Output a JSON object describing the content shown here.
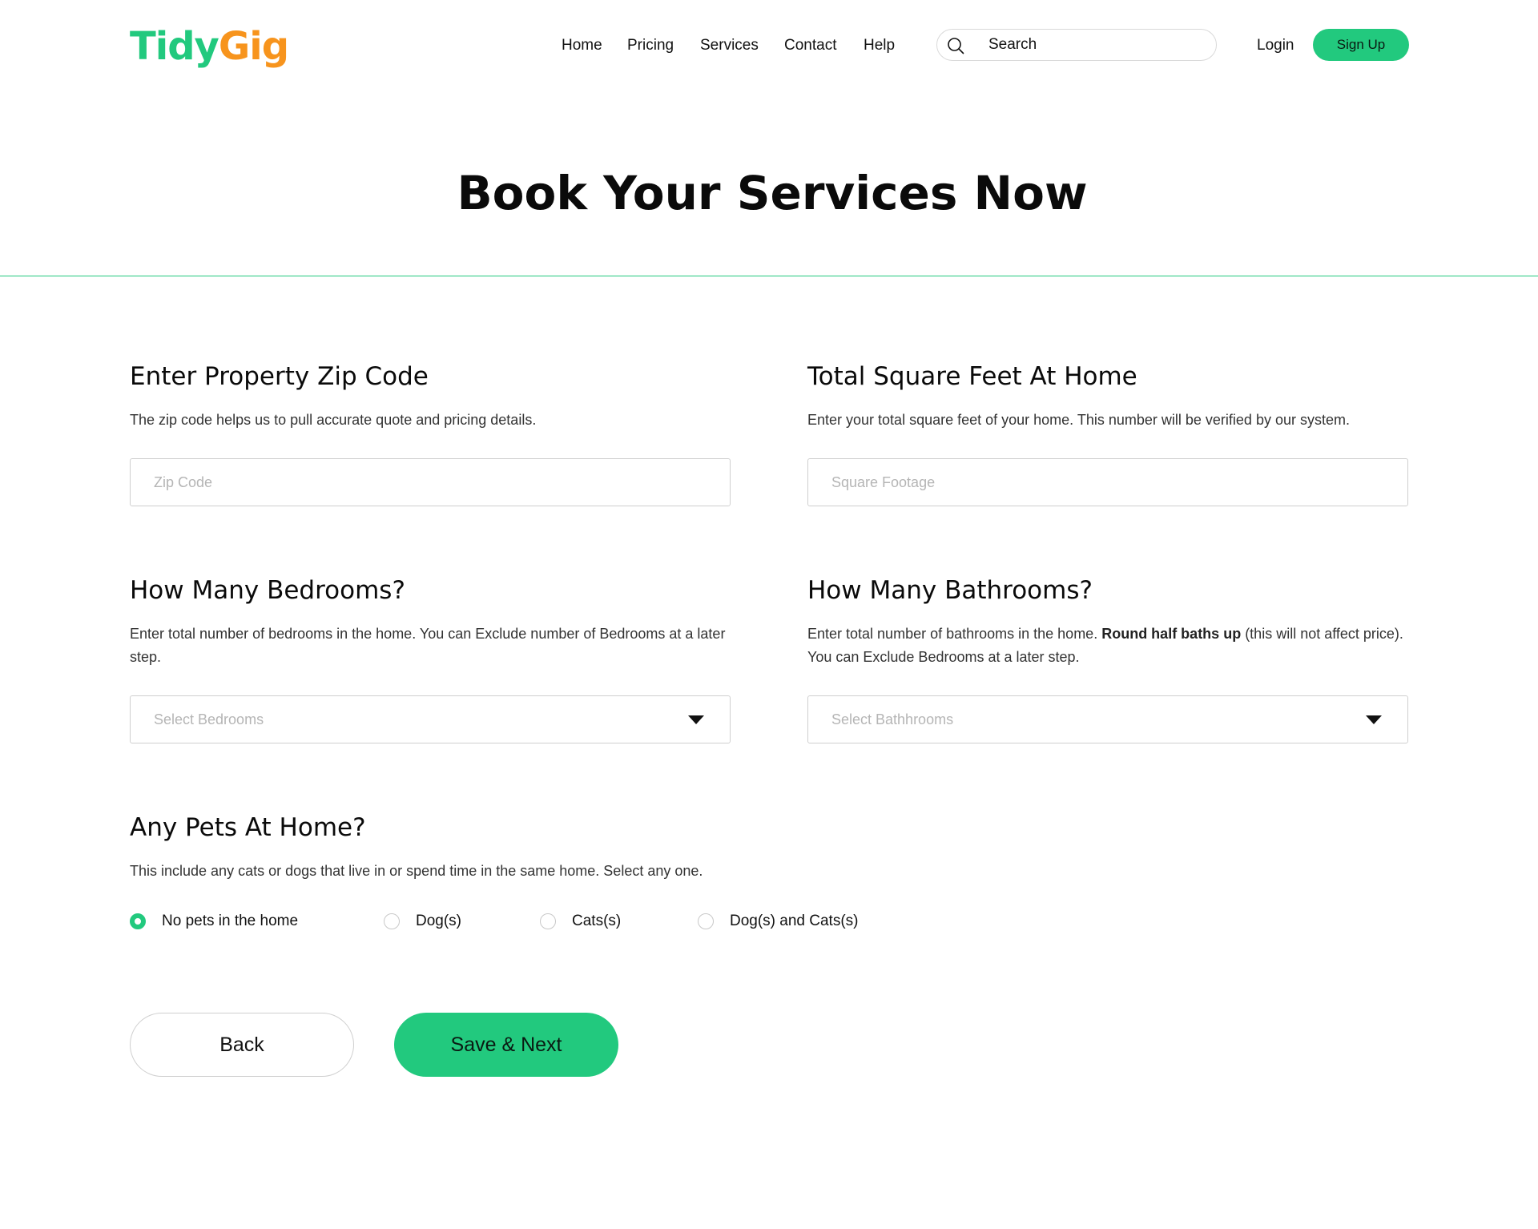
{
  "brand": {
    "part1": "Tidy",
    "part2": "Gig"
  },
  "nav": {
    "items": [
      "Home",
      "Pricing",
      "Services",
      "Contact",
      "Help"
    ],
    "search_placeholder": "Search",
    "login": "Login",
    "signup": "Sign Up"
  },
  "page": {
    "title": "Book Your Services Now"
  },
  "form": {
    "zip": {
      "title": "Enter Property Zip Code",
      "description": "The zip code helps us to pull accurate quote and pricing details.",
      "placeholder": "Zip Code"
    },
    "sqft": {
      "title": "Total Square Feet At Home",
      "description": "Enter your total square feet of your home. This number will be verified by our system.",
      "placeholder": "Square Footage"
    },
    "bedrooms": {
      "title": "How Many Bedrooms?",
      "description": "Enter total number of bedrooms in the home. You can Exclude number of Bedrooms at a later step.",
      "placeholder": "Select Bedrooms"
    },
    "bathrooms": {
      "title": "How Many Bathrooms?",
      "description_pre": "Enter total number of bathrooms in the home. ",
      "description_bold": "Round half baths up",
      "description_post": " (this will not affect price). You can Exclude Bedrooms at a later step.",
      "placeholder": "Select Bathhrooms"
    },
    "pets": {
      "title": "Any Pets At Home?",
      "description": "This include any cats or dogs that live in or spend time in the same home. Select any one.",
      "options": [
        "No pets in the home",
        "Dog(s)",
        "Cats(s)",
        "Dog(s) and Cats(s)"
      ],
      "selected_index": 0
    }
  },
  "actions": {
    "back": "Back",
    "next": "Save & Next"
  },
  "colors": {
    "accent": "#22c97e",
    "brand_secondary": "#f7941d"
  }
}
